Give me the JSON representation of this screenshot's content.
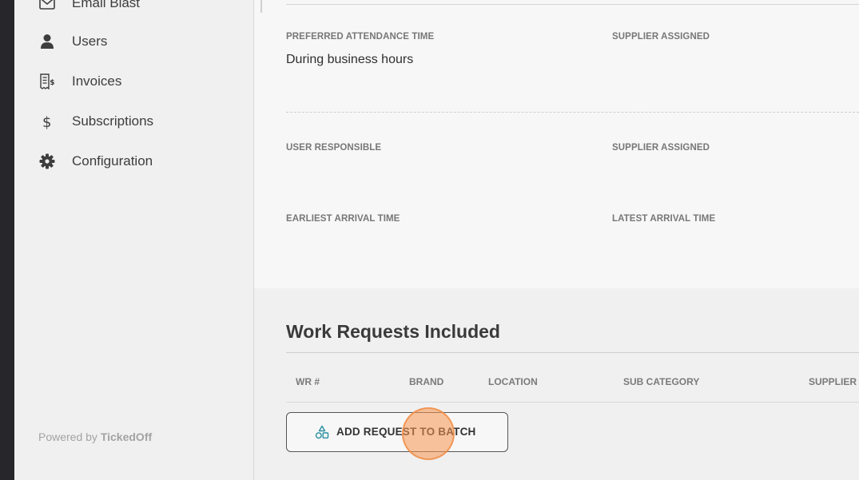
{
  "sidebar": {
    "items": [
      {
        "label": "Email Blast",
        "icon": "mail-icon"
      },
      {
        "label": "Users",
        "icon": "user-icon"
      },
      {
        "label": "Invoices",
        "icon": "invoice-icon"
      },
      {
        "label": "Subscriptions",
        "icon": "dollar-icon"
      },
      {
        "label": "Configuration",
        "icon": "gear-icon"
      }
    ],
    "powered_prefix": "Powered by ",
    "powered_brand": "TickedOff"
  },
  "details": {
    "preferred_attendance_label": "PREFERRED ATTENDANCE TIME",
    "preferred_attendance_value": "During business hours",
    "supplier_assigned_label_1": "SUPPLIER ASSIGNED",
    "user_responsible_label": "USER RESPONSIBLE",
    "supplier_assigned_label_2": "SUPPLIER ASSIGNED",
    "earliest_arrival_label": "EARLIEST ARRIVAL TIME",
    "latest_arrival_label": "LATEST ARRIVAL TIME"
  },
  "work_requests": {
    "title": "Work Requests Included",
    "columns": [
      "WR #",
      "BRAND",
      "LOCATION",
      "SUB CATEGORY",
      "SUPPLIER A"
    ],
    "add_button_label": "ADD REQUEST TO BATCH"
  },
  "colors": {
    "accent_teal": "#2a8fa0",
    "click_marker": "#f5964f"
  }
}
